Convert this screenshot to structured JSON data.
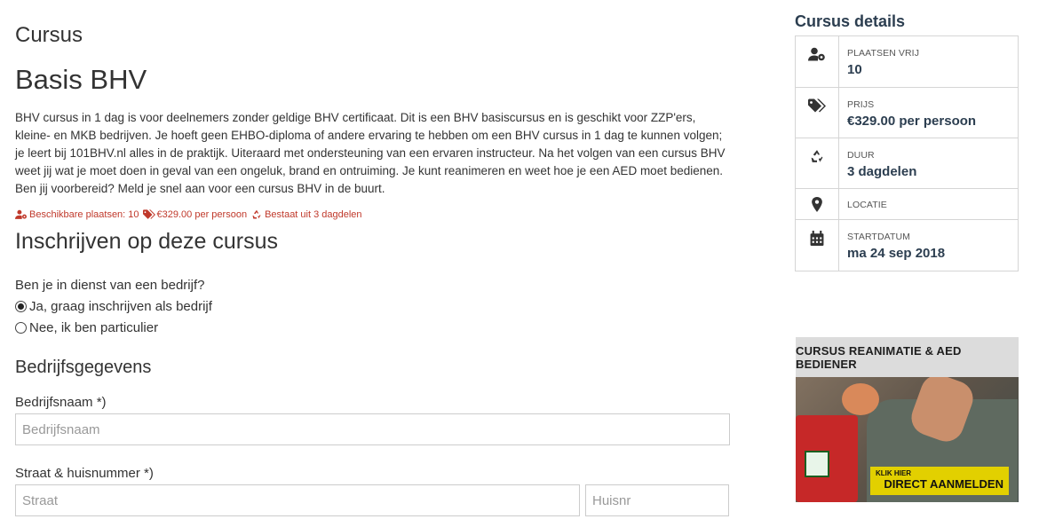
{
  "main": {
    "section_label": "Cursus",
    "course_title": "Basis BHV",
    "description": "BHV cursus in 1 dag is voor deelnemers zonder geldige BHV certificaat. Dit is een BHV basiscursus en is geschikt voor ZZP'ers, kleine- en MKB bedrijven. Je hoeft geen EHBO-diploma of andere ervaring te hebben om een BHV cursus in 1 dag te kunnen volgen; je leert bij 101BHV.nl alles in de praktijk. Uiteraard met ondersteuning van een ervaren instructeur. Na het volgen van een cursus BHV weet jij wat je moet doen in geval van een ongeluk, brand en ontruiming. Je kunt reanimeren en weet hoe je een AED moet bedienen. Ben jij voorbereid? Meld je snel aan voor een cursus BHV in de buurt.",
    "meta": {
      "places": "Beschikbare plaatsen: 10",
      "price": "€329.00 per persoon",
      "duration": "Bestaat uit 3 dagdelen",
      "accent_color": "#c0392b"
    }
  },
  "form": {
    "heading": "Inschrijven op deze cursus",
    "question": "Ben je in dienst van een bedrijf?",
    "options": [
      {
        "label": "Ja, graag inschrijven als bedrijf",
        "checked": true
      },
      {
        "label": "Nee, ik ben particulier",
        "checked": false
      }
    ],
    "company_heading": "Bedrijfsgegevens",
    "company_label": "Bedrijfsnaam *)",
    "company_placeholder": "Bedrijfsnaam",
    "street_label": "Straat & huisnummer *)",
    "street_placeholder": "Straat",
    "number_placeholder": "Huisnr"
  },
  "sidebar": {
    "heading": "Cursus details",
    "details": [
      {
        "icon": "user-gear-icon",
        "key": "PLAATSEN VRIJ",
        "value": "10"
      },
      {
        "icon": "tags-icon",
        "key": "PRIJS",
        "value": "€329.00 per persoon"
      },
      {
        "icon": "recycle-icon",
        "key": "DUUR",
        "value": "3 dagdelen"
      },
      {
        "icon": "map-marker-icon",
        "key": "LOCATIE",
        "value": ""
      },
      {
        "icon": "calendar-icon",
        "key": "STARTDATUM",
        "value": "ma 24 sep 2018"
      }
    ],
    "banner": {
      "title": "CURSUS REANIMATIE & AED BEDIENER",
      "cta_small": "KLIK HIER",
      "cta_big": "DIRECT AANMELDEN"
    }
  },
  "colors": {
    "heading_dark": "#2c3e50",
    "text": "#333333",
    "border": "#d5d5d5",
    "cta_yellow": "#e2d000"
  }
}
